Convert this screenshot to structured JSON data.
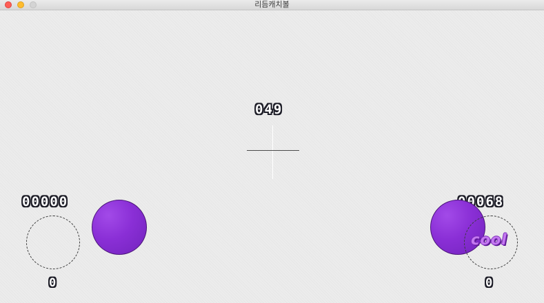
{
  "window": {
    "title": "리듬캐치볼"
  },
  "hud": {
    "timer": "049",
    "left_player": {
      "score": "00000",
      "combo": "0"
    },
    "right_player": {
      "score": "00068",
      "combo": "0",
      "judgment": "cool"
    }
  },
  "colors": {
    "ball": "#8a2fd6",
    "judgment": "#c478f0",
    "digit_outline": "#1e1e28"
  }
}
